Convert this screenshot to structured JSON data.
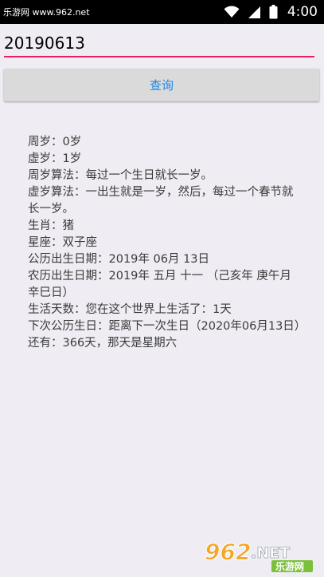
{
  "status_bar": {
    "watermark": "乐游网 www.962.net",
    "time": "4:00",
    "bg": "#000000",
    "icons": [
      "wifi-icon",
      "signal-icon",
      "battery-icon"
    ]
  },
  "input": {
    "value": "20190613",
    "underline_color": "#e91e63"
  },
  "query_button": {
    "label": "查询",
    "color": "#1e88e5"
  },
  "result": {
    "lines": [
      "周岁：0岁",
      "虚岁：1岁",
      "周岁算法：每过一个生日就长一岁。",
      "虚岁算法：一出生就是一岁，然后，每过一个春节就长一岁。",
      "生肖：猪",
      "星座：双子座",
      "公历出生日期：2019年 06月 13日",
      "农历出生日期：2019年 五月 十一 （己亥年 庚午月 辛巳日）",
      "生活天数：您在这个世界上生活了：1天",
      "下次公历生日：距离下一次生日（2020年06月13日）还有：366天，那天是星期六"
    ]
  },
  "watermark_logo": {
    "number": "962",
    "suffix": ".NET",
    "tagline": "乐游网"
  }
}
